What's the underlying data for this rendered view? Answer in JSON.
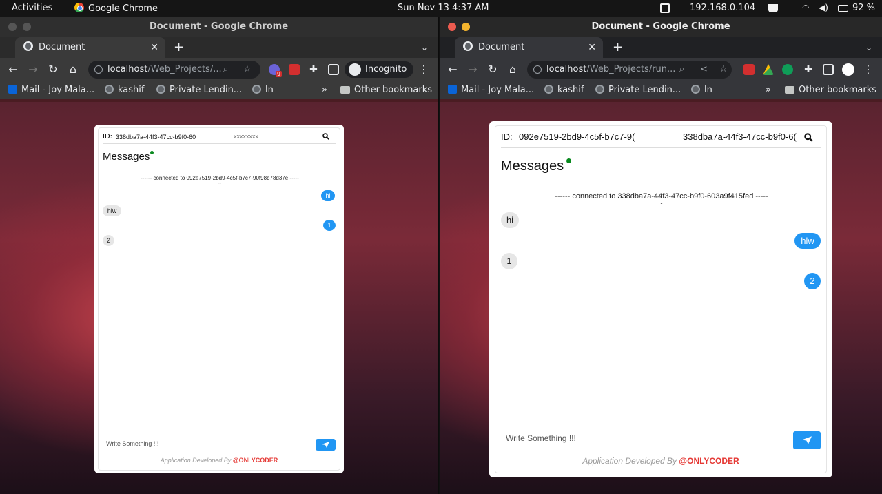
{
  "topbar": {
    "activities": "Activities",
    "app": "Google Chrome",
    "datetime": "Sun Nov 13  4:37 AM",
    "ip": "192.168.0.104",
    "battery": "92 %"
  },
  "left_window": {
    "title": "Document - Google Chrome",
    "tab_label": "Document",
    "url_host": "localhost",
    "url_path": "/Web_Projects/...",
    "incognito_label": "Incognito",
    "ext_badge": "9",
    "bookmarks": [
      "Mail - Joy Mala...",
      "kashif",
      "Private Lendin...",
      "ln"
    ],
    "overflow": "»",
    "other_bookmarks": "Other bookmarks",
    "app": {
      "id_label": "ID:",
      "id_value": "338dba7a-44f3-47cc-b9f0-60",
      "peer_placeholder": "xxxxxxxx",
      "messages_title": "Messages",
      "connection_text": "------  connected to 092e7519-2bd9-4c5f-b7c7-90f98b78d37e  -----",
      "connection_tail": "--",
      "messages": [
        {
          "text": "hi",
          "dir": "out"
        },
        {
          "text": "hlw",
          "dir": "in"
        },
        {
          "text": "1",
          "dir": "out"
        },
        {
          "text": "2",
          "dir": "in"
        }
      ],
      "write_placeholder": "Write Something !!!",
      "footer_dev": "Application Developed By ",
      "footer_brand": "@ONLYCODER"
    }
  },
  "right_window": {
    "title": "Document - Google Chrome",
    "tab_label": "Document",
    "url_host": "localhost",
    "url_path": "/Web_Projects/run...",
    "bookmarks": [
      "Mail - Joy Mala...",
      "kashif",
      "Private Lendin...",
      "ln"
    ],
    "overflow": "»",
    "other_bookmarks": "Other bookmarks",
    "app": {
      "id_label": "ID:",
      "id_value": "092e7519-2bd9-4c5f-b7c7-9(",
      "peer_value": "338dba7a-44f3-47cc-b9f0-6(",
      "messages_title": "Messages",
      "connection_text": "------  connected to 338dba7a-44f3-47cc-b9f0-603a9f415fed  -----",
      "connection_tail": "-",
      "messages": [
        {
          "text": "hi",
          "dir": "in"
        },
        {
          "text": "hlw",
          "dir": "out"
        },
        {
          "text": "1",
          "dir": "in"
        },
        {
          "text": "2",
          "dir": "out"
        }
      ],
      "write_placeholder": "Write Something !!!",
      "footer_dev": "Application Developed By ",
      "footer_brand": "@ONLYCODER"
    }
  },
  "colors": {
    "accent": "#2196f3",
    "brand": "#e53935",
    "online": "#0a8a1f"
  }
}
